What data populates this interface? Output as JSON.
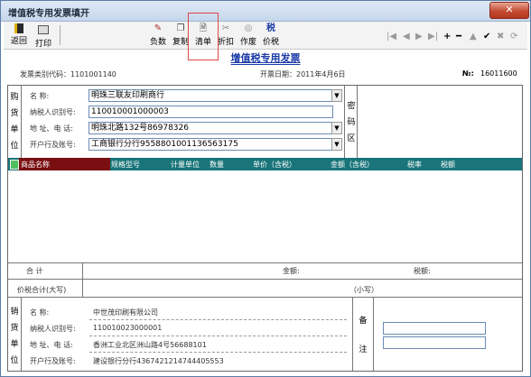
{
  "window": {
    "title": "增值税专用发票填开",
    "close": "✕"
  },
  "toolbar": {
    "back": "返回",
    "print": "打印",
    "negative": "负数",
    "copy": "复制",
    "list": "清单",
    "discount": "折扣",
    "void": "作废",
    "tax_price_icon": "税",
    "tax_price": "价税"
  },
  "invoice": {
    "title": "增值税专用发票",
    "category_code": "发票类别代码：1101001140",
    "date": "开票日期：2011年4月6日",
    "number_label": "№:",
    "number": "16011600"
  },
  "buyer": {
    "side_label": [
      "购",
      "货",
      "单",
      "位"
    ],
    "name_label": "名      称:",
    "name": "明珠三联友印刷商行",
    "taxid_label": "纳税人识别号:",
    "taxid": "110010001000003",
    "addr_label": "地 址、电 话:",
    "addr": "明珠北路132号86978326",
    "bank_label": "开户行及账号:",
    "bank": "工商银行分行9558801001136563175"
  },
  "password_area": [
    "密",
    "码",
    "区"
  ],
  "goods_columns": [
    "商品名称",
    "规格型号",
    "计量单位",
    "数量",
    "单价（含税）",
    "金额（含税）",
    "税率",
    "税额"
  ],
  "totals": {
    "total_label": "合         计",
    "amount_label": "金额:",
    "tax_label": "税额:",
    "sum_label": "价税合计(大写)",
    "small_label": "（小写）"
  },
  "seller": {
    "side_label": [
      "销",
      "货",
      "单",
      "位"
    ],
    "name_label": "名      称:",
    "name": "中世茂印刷有限公司",
    "taxid_label": "纳税人识别号:",
    "taxid": "110010023000001",
    "addr_label": "地 址、电 话:",
    "addr": "香洲工业北区洲山路4号56688101",
    "bank_label": "开户行及账号:",
    "bank": "建设银行分行4367421214744405553"
  },
  "remark": [
    "备",
    "注"
  ],
  "dropdown_arrow": "▼"
}
